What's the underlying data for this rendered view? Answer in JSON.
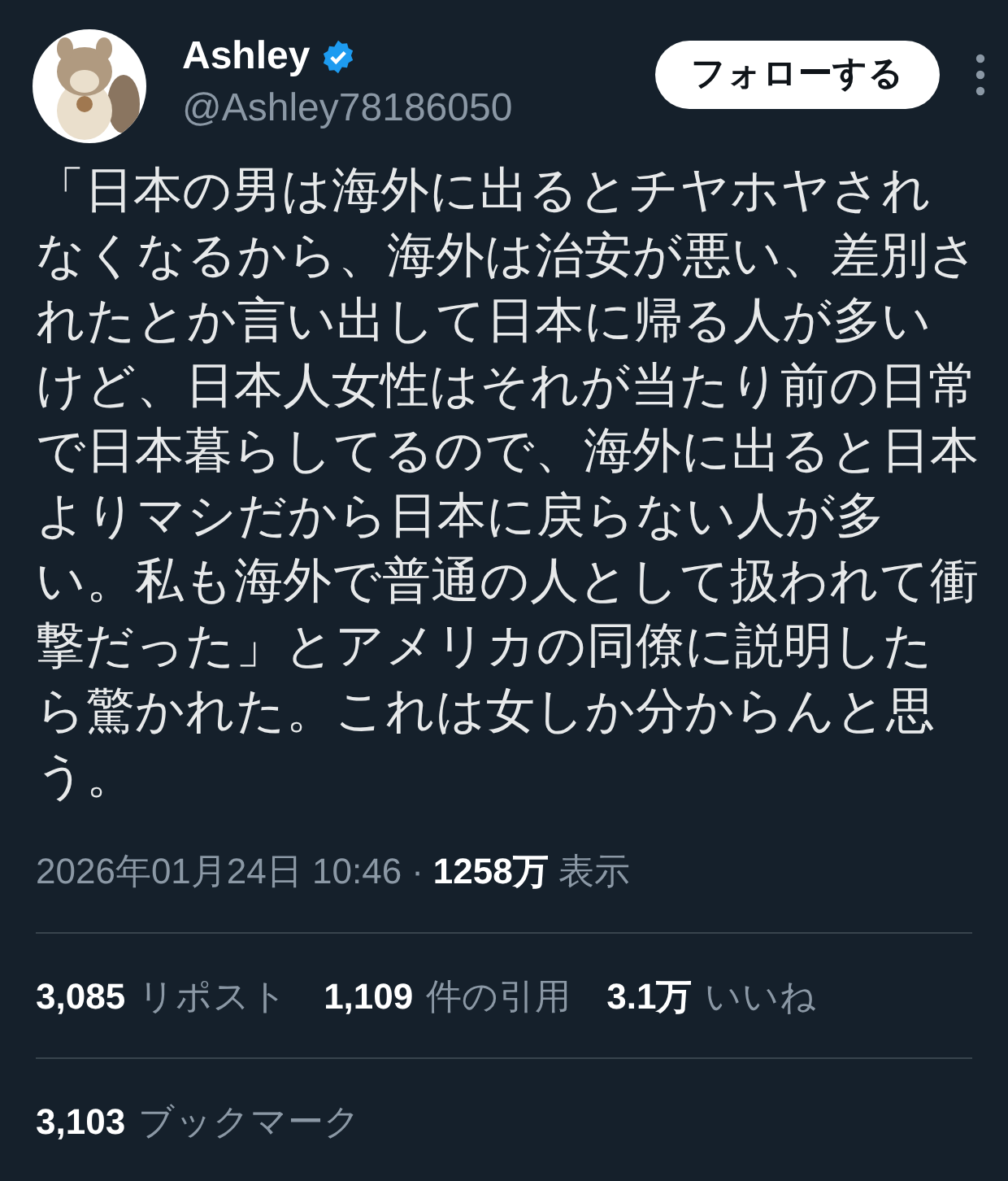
{
  "author": {
    "name": "Ashley",
    "verified": true,
    "handle": "@Ashley78186050"
  },
  "follow_button": "フォローする",
  "body": "「日本の男は海外に出るとチヤホヤされなくなるから、海外は治安が悪い、差別されたとか言い出して日本に帰る人が多いけど、日本人女性はそれが当たり前の日常で日本暮らしてるので、海外に出ると日本よりマシだから日本に戻らない人が多い。私も海外で普通の人として扱われて衝撃だった」とアメリカの同僚に説明したら驚かれた。これは女しか分からんと思う。",
  "timestamp": "2026年01月24日 10:46",
  "separator": "·",
  "views": {
    "count": "1258万",
    "label": "表示"
  },
  "stats": [
    {
      "count": "3,085",
      "label": "リポスト"
    },
    {
      "count": "1,109",
      "label": "件の引用"
    },
    {
      "count": "3.1万",
      "label": "いいね"
    }
  ],
  "bookmarks": {
    "count": "3,103",
    "label": "ブックマーク"
  }
}
